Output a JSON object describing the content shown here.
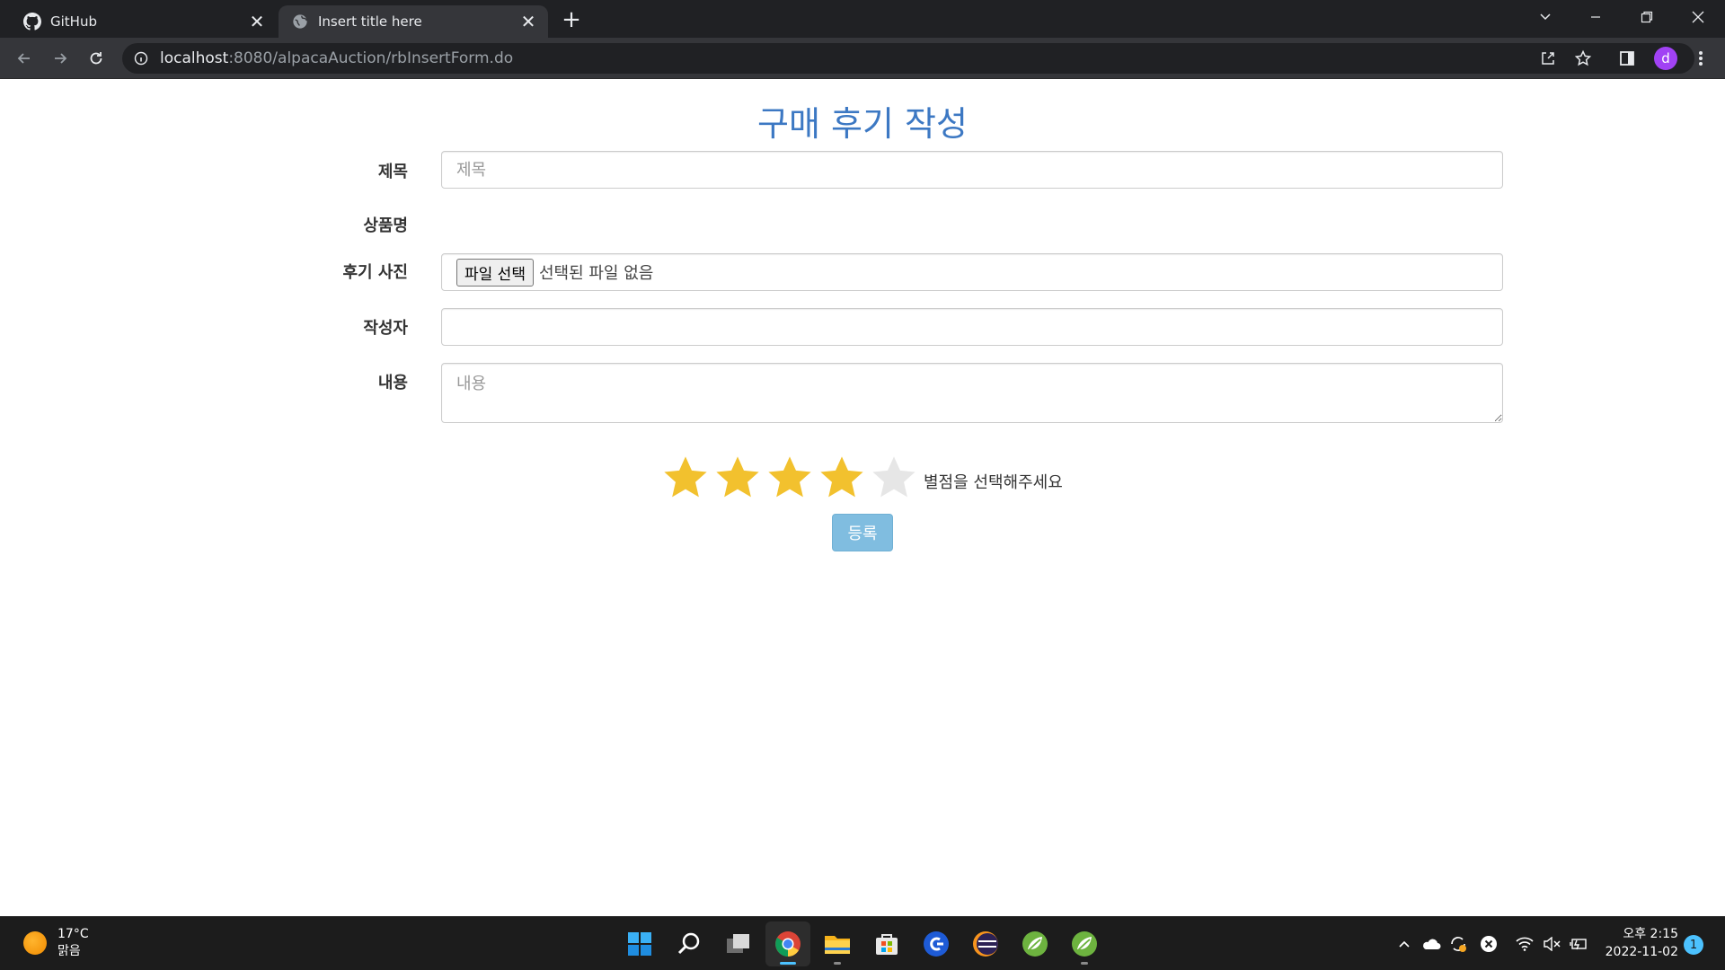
{
  "browser": {
    "tabs": [
      {
        "title": "GitHub",
        "icon": "github-icon"
      },
      {
        "title": "Insert title here",
        "icon": "globe-icon"
      }
    ],
    "url_host": "localhost",
    "url_rest": ":8080/alpacaAuction/rbInsertForm.do",
    "profile_initial": "d"
  },
  "page": {
    "title": "구매 후기 작성",
    "fields": {
      "subject": {
        "label": "제목",
        "placeholder": "제목",
        "value": ""
      },
      "product": {
        "label": "상품명",
        "value": ""
      },
      "photo": {
        "label": "후기 사진",
        "button": "파일 선택",
        "status": "선택된 파일 없음"
      },
      "writer": {
        "label": "작성자",
        "value": ""
      },
      "content": {
        "label": "내용",
        "placeholder": "내용",
        "value": ""
      }
    },
    "rating": {
      "value": 4,
      "max": 5,
      "prompt": "별점을 선택해주세요",
      "filled_color": "#f2c12e",
      "empty_color": "#e6e6e6"
    },
    "submit_label": "등록",
    "accent_color": "#3c78c3"
  },
  "taskbar": {
    "weather": {
      "temp": "17°C",
      "condition": "맑음"
    },
    "clock": {
      "time": "오후 2:15",
      "date": "2022-11-02"
    },
    "notification_count": "1",
    "apps": [
      "windows-start-icon",
      "search-icon",
      "task-view-icon",
      "chrome-icon",
      "file-explorer-icon",
      "microsoft-store-icon",
      "app-icon",
      "eclipse-icon",
      "spring-tool-suite-icon",
      "spring-tool-suite-icon"
    ]
  }
}
